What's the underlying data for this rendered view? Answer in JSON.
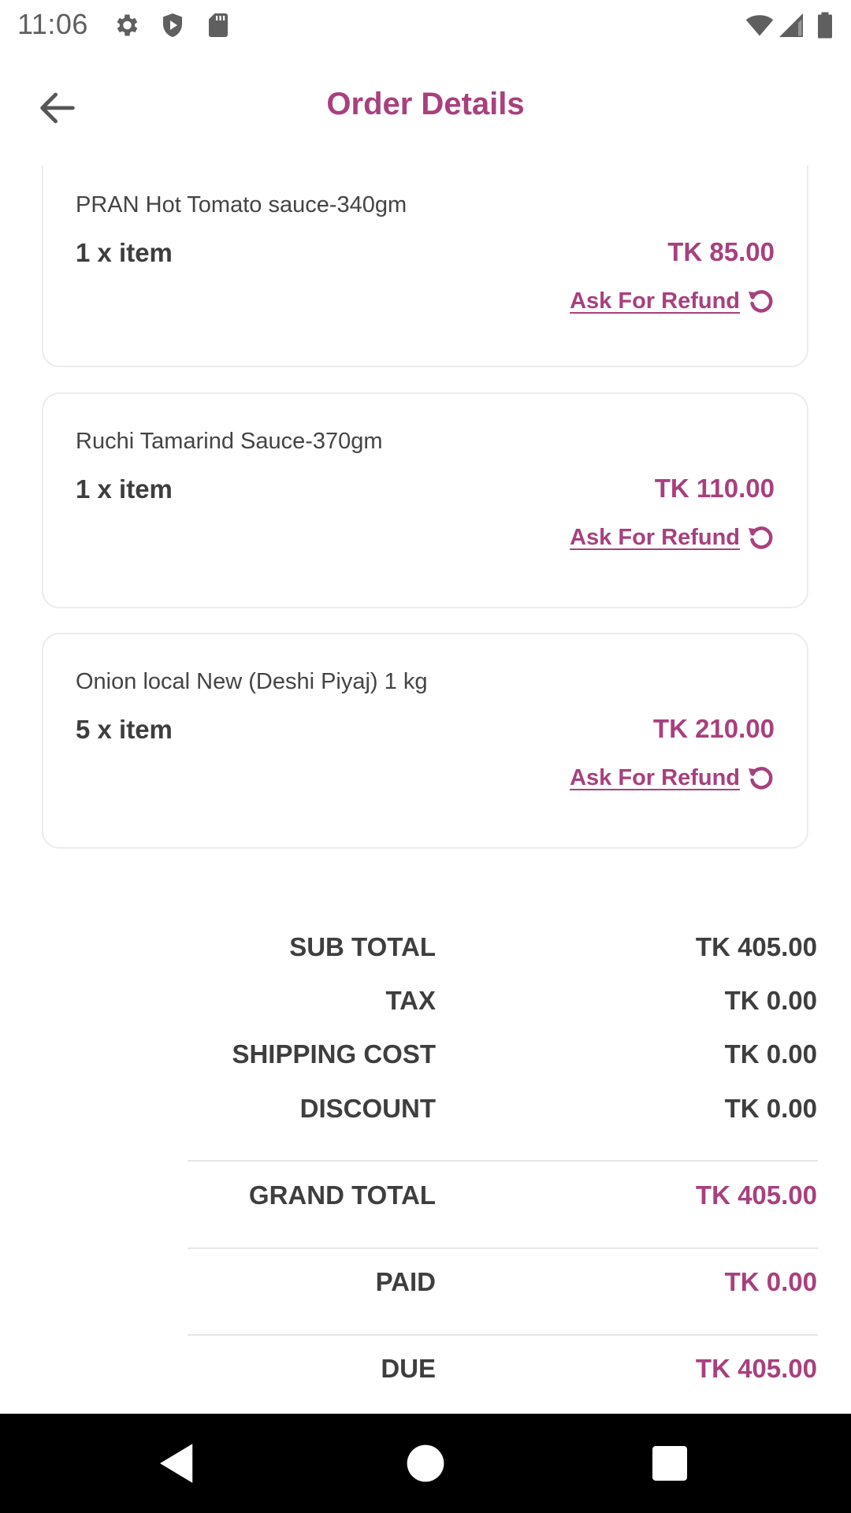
{
  "status_bar": {
    "time": "11:06",
    "icons": [
      "settings-icon",
      "shield-icon",
      "sd-card-icon",
      "wifi-icon",
      "signal-icon",
      "battery-icon"
    ]
  },
  "app_bar": {
    "title": "Order Details",
    "back_icon": "arrow-back-icon"
  },
  "items": [
    {
      "name": "PRAN Hot Tomato sauce-340gm",
      "qty": "1 x item",
      "price": "TK 85.00",
      "refund_label": "Ask For Refund"
    },
    {
      "name": "Ruchi Tamarind Sauce-370gm",
      "qty": "1 x item",
      "price": "TK 110.00",
      "refund_label": "Ask For Refund"
    },
    {
      "name": "Onion local New (Deshi Piyaj) 1 kg",
      "qty": "5 x item",
      "price": "TK 210.00",
      "refund_label": "Ask For Refund"
    }
  ],
  "summary": {
    "sub_total": {
      "label": "SUB TOTAL",
      "value": "TK 405.00"
    },
    "tax": {
      "label": "TAX",
      "value": "TK 0.00"
    },
    "shipping": {
      "label": "SHIPPING COST",
      "value": "TK 0.00"
    },
    "discount": {
      "label": "DISCOUNT",
      "value": "TK 0.00"
    },
    "grand_total": {
      "label": "GRAND TOTAL",
      "value": "TK 405.00"
    },
    "paid": {
      "label": "PAID",
      "value": "TK 0.00"
    },
    "due": {
      "label": "DUE",
      "value": "TK 405.00"
    }
  },
  "colors": {
    "accent": "#a8407e",
    "text": "#3e3e3e",
    "card_border": "#ececec"
  },
  "nav_bar": {
    "icons": [
      "back-triangle-icon",
      "home-circle-icon",
      "recents-square-icon"
    ]
  }
}
